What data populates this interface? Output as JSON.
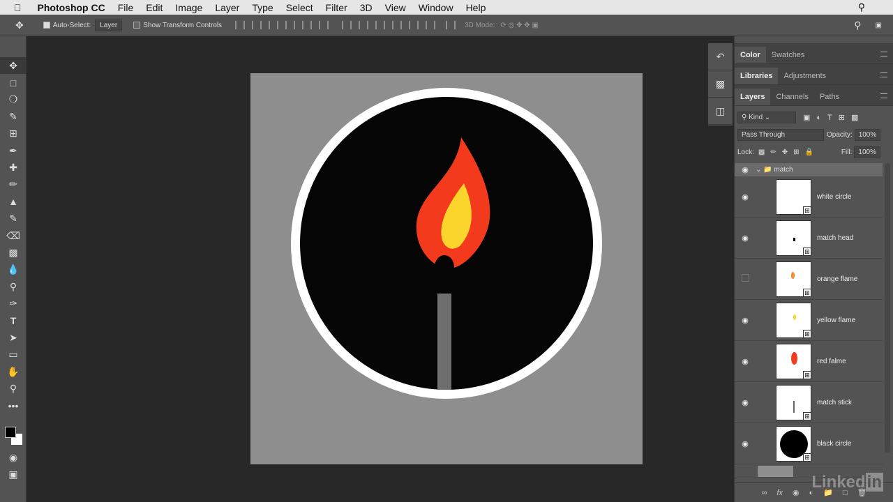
{
  "menubar": {
    "app": "Photoshop CC",
    "items": [
      "File",
      "Edit",
      "Image",
      "Layer",
      "Type",
      "Select",
      "Filter",
      "3D",
      "View",
      "Window",
      "Help"
    ]
  },
  "options": {
    "auto_select_label": "Auto-Select:",
    "auto_select_value": "Layer",
    "show_transform": "Show Transform Controls",
    "mode_3d": "3D Mode:"
  },
  "tools": [
    "move",
    "marquee",
    "lasso",
    "quick-select",
    "crop",
    "eyedropper",
    "healing",
    "brush",
    "stamp",
    "history-brush",
    "eraser",
    "gradient",
    "blur",
    "dodge",
    "pen",
    "type",
    "path-select",
    "rectangle",
    "hand",
    "zoom",
    "more"
  ],
  "panels": {
    "color_tabs": [
      "Color",
      "Swatches"
    ],
    "library_tabs": [
      "Libraries",
      "Adjustments"
    ],
    "layer_tabs": [
      "Layers",
      "Channels",
      "Paths"
    ],
    "filter_kind": "Kind",
    "blend_mode": "Pass Through",
    "opacity_label": "Opacity:",
    "opacity": "100%",
    "lock_label": "Lock:",
    "fill_label": "Fill:",
    "fill": "100%",
    "group": "match",
    "layers": [
      {
        "name": "white circle",
        "visible": true
      },
      {
        "name": "match head",
        "visible": true
      },
      {
        "name": "orange flame",
        "visible": false
      },
      {
        "name": "yellow flame",
        "visible": true
      },
      {
        "name": "red falme",
        "visible": true
      },
      {
        "name": "match stick",
        "visible": true
      },
      {
        "name": "black circle",
        "visible": true
      }
    ]
  },
  "colors": {
    "red": "#f43a1c",
    "yellow": "#fbd52c",
    "stick": "#6e6e6e",
    "bg": "#8e8e8e"
  },
  "watermark": "LinkedIn"
}
